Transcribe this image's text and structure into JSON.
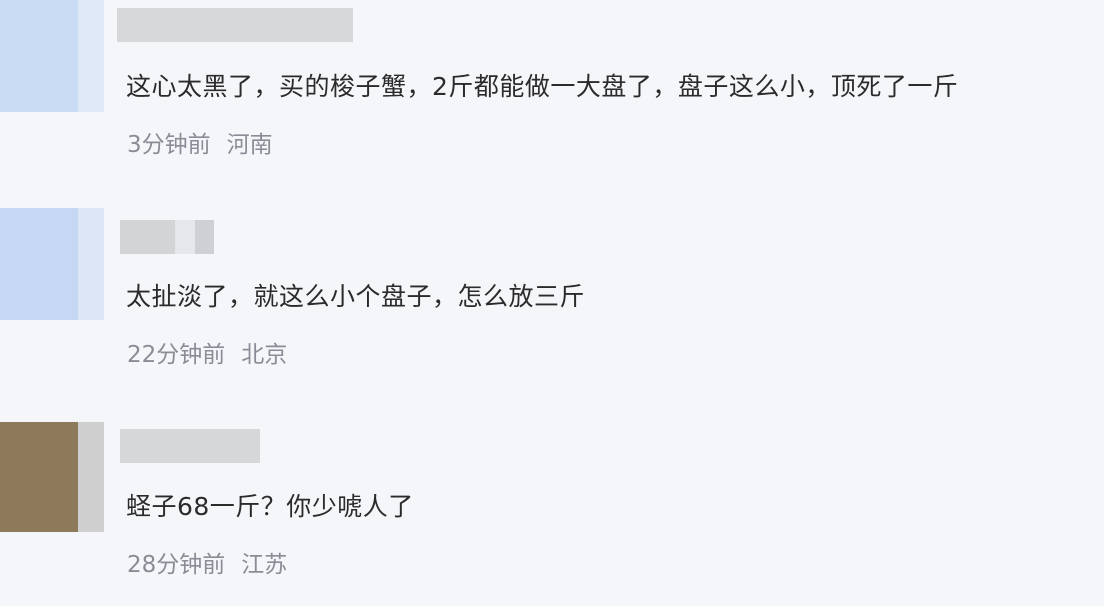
{
  "comments": [
    {
      "text": "这心太黑了，买的梭子蟹，2斤都能做一大盘了，盘子这么小，顶死了一斤",
      "time": "3分钟前",
      "location": "河南"
    },
    {
      "text": "太扯淡了，就这么小个盘子，怎么放三斤",
      "time": "22分钟前",
      "location": "北京"
    },
    {
      "text": "蛏子68一斤？你少唬人了",
      "time": "28分钟前",
      "location": "江苏"
    }
  ],
  "colors": {
    "background": "#f5f6fa",
    "text": "#2b2b2b",
    "meta": "#8a8d96",
    "avatar_blue": "#c9d9f3",
    "avatar_brown": "#8e7b5c",
    "name_blur": "#d6d6d8"
  }
}
